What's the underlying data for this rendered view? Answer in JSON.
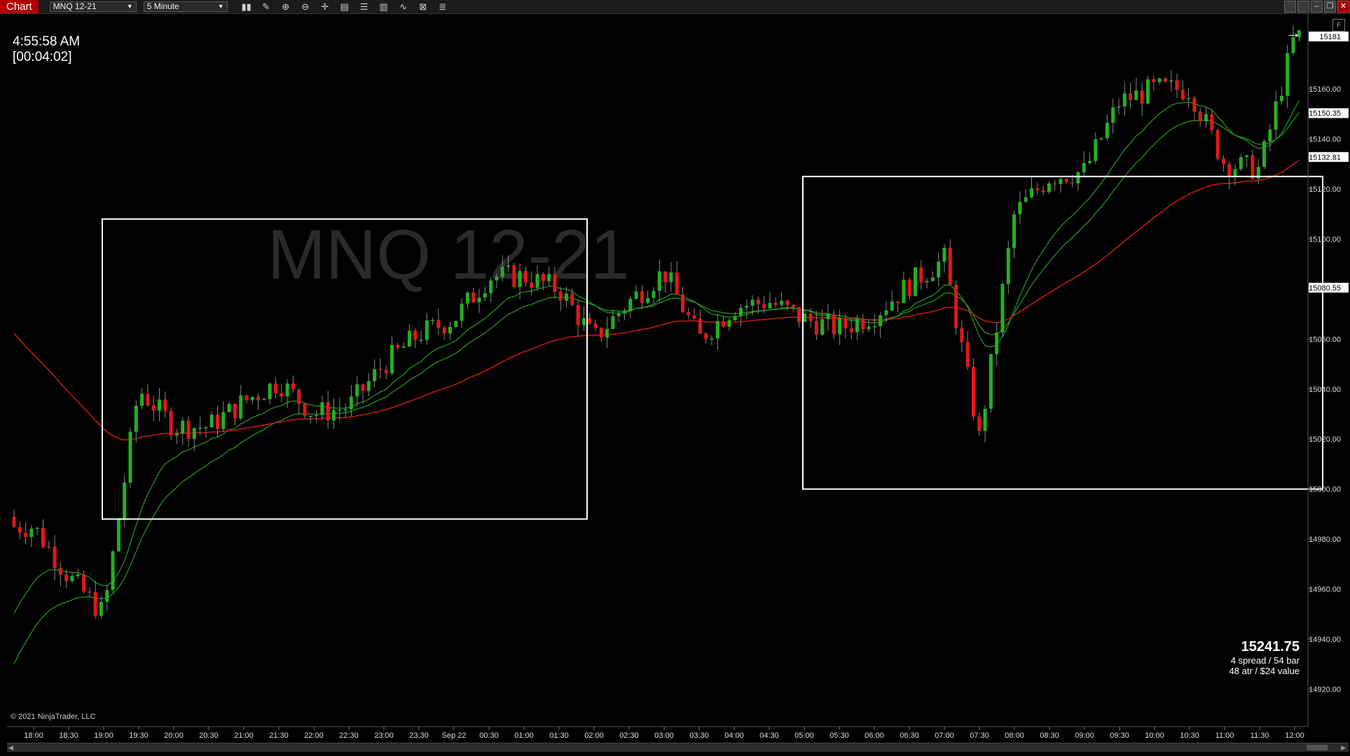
{
  "toolbar": {
    "chart_tab": "Chart",
    "instrument": "MNQ 12-21",
    "interval": "5 Minute",
    "icons": [
      "bar-type-icon",
      "drawing-tool-icon",
      "zoom-in-icon",
      "zoom-out-icon",
      "crosshair-icon",
      "data-box-icon",
      "properties-icon",
      "strategies-icon",
      "indicators-icon",
      "templates-icon",
      "chart-trader-icon"
    ]
  },
  "clock": {
    "time": "4:55:58 AM",
    "bar_timer": "[00:04:02]"
  },
  "watermark": "MNQ 12-21",
  "price_axis": {
    "ticks": [
      "15160.00",
      "15140.00",
      "15120.00",
      "15100.00",
      "15060.00",
      "15040.00",
      "15020.00",
      "15000.00",
      "14980.00",
      "14960.00",
      "14940.00",
      "14920.00"
    ],
    "flags": [
      {
        "label": "15181",
        "color": "#ffffff"
      },
      {
        "label": "15150.35",
        "color": "#ffffff"
      },
      {
        "label": "15132.81",
        "color": "#ffffff"
      },
      {
        "label": "15080.55",
        "color": "#ffffff"
      }
    ]
  },
  "time_axis": [
    "18:00",
    "18:30",
    "19:00",
    "19:30",
    "20:00",
    "20:30",
    "21:00",
    "21:30",
    "22:00",
    "22:30",
    "23:00",
    "23:30",
    "Sep 22",
    "00:30",
    "01:00",
    "01:30",
    "02:00",
    "02:30",
    "03:00",
    "03:30",
    "04:00",
    "04:30",
    "05:00",
    "05:30",
    "06:00",
    "06:30",
    "07:00",
    "07:30",
    "08:00",
    "08:30",
    "09:00",
    "09:30",
    "10:00",
    "10:30",
    "11:00",
    "11:30",
    "12:00"
  ],
  "info_box": {
    "price": "15241.75",
    "line1": "4 spread / 54 bar",
    "line2": "48 atr / $24 value"
  },
  "copyright": "© 2021 NinjaTrader, LLC",
  "colors": {
    "up": "#22b022",
    "down": "#e01818",
    "ma_red": "#d41c1c",
    "ma_green": "#1e8a1e",
    "tab": "#b20000"
  },
  "chart_data": {
    "type": "candlestick",
    "ylim": [
      14905,
      15190
    ],
    "x": [
      "18:00",
      "18:30",
      "19:00",
      "19:30",
      "20:00",
      "20:30",
      "21:00",
      "21:30",
      "22:00",
      "22:30",
      "23:00",
      "23:30",
      "Sep 22",
      "00:30",
      "01:00",
      "01:30",
      "02:00",
      "02:30",
      "03:00",
      "03:30",
      "04:00",
      "04:30",
      "05:00",
      "05:30",
      "06:00",
      "06:30",
      "07:00",
      "07:30",
      "08:00",
      "08:30",
      "09:00",
      "09:30",
      "10:00",
      "10:30",
      "11:00",
      "11:30",
      "12:00"
    ],
    "closes": [
      14985,
      14965,
      14950,
      15040,
      15025,
      15025,
      15035,
      15043,
      15030,
      15033,
      15050,
      15062,
      15068,
      15085,
      15085,
      15080,
      15060,
      15075,
      15087,
      15060,
      15073,
      15075,
      15068,
      15064,
      15070,
      15082,
      15092,
      15020,
      15110,
      15125,
      15127,
      15155,
      15160,
      15160,
      15130,
      15128,
      15181
    ],
    "boxes": [
      {
        "from": "18:30",
        "to": "01:30",
        "high": 15108,
        "low": 14988
      },
      {
        "from": "04:30",
        "to": "12:00",
        "high": 15125,
        "low": 15000
      }
    ]
  }
}
